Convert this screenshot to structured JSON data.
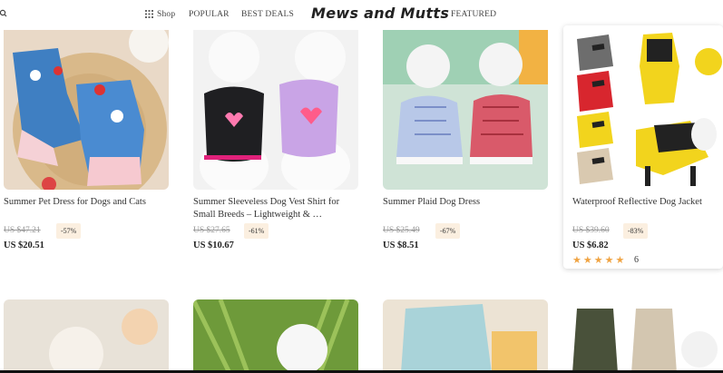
{
  "nav": {
    "shop_label": "Shop",
    "popular_label": "POPULAR",
    "best_deals_label": "BEST DEALS",
    "brand": "Mews and Mutts",
    "featured_label": "FEATURED"
  },
  "products": [
    {
      "title": "Summer Pet Dress for Dogs and Cats",
      "old_price": "US $47.21",
      "discount": "-57%",
      "price": "US $20.51"
    },
    {
      "title": "Summer Sleeveless Dog Vest Shirt for Small Breeds – Lightweight & …",
      "old_price": "US $27.65",
      "discount": "-61%",
      "price": "US $10.67"
    },
    {
      "title": "Summer Plaid Dog Dress",
      "old_price": "US $25.49",
      "discount": "-67%",
      "price": "US $8.51"
    },
    {
      "title": "Waterproof Reflective Dog Jacket",
      "old_price": "US $39.60",
      "discount": "-83%",
      "price": "US $6.82",
      "stars": "★★★★★",
      "review_count": "6"
    }
  ],
  "colors": {
    "accent_star": "#f0a443",
    "discount_bg": "#fbefe0"
  }
}
